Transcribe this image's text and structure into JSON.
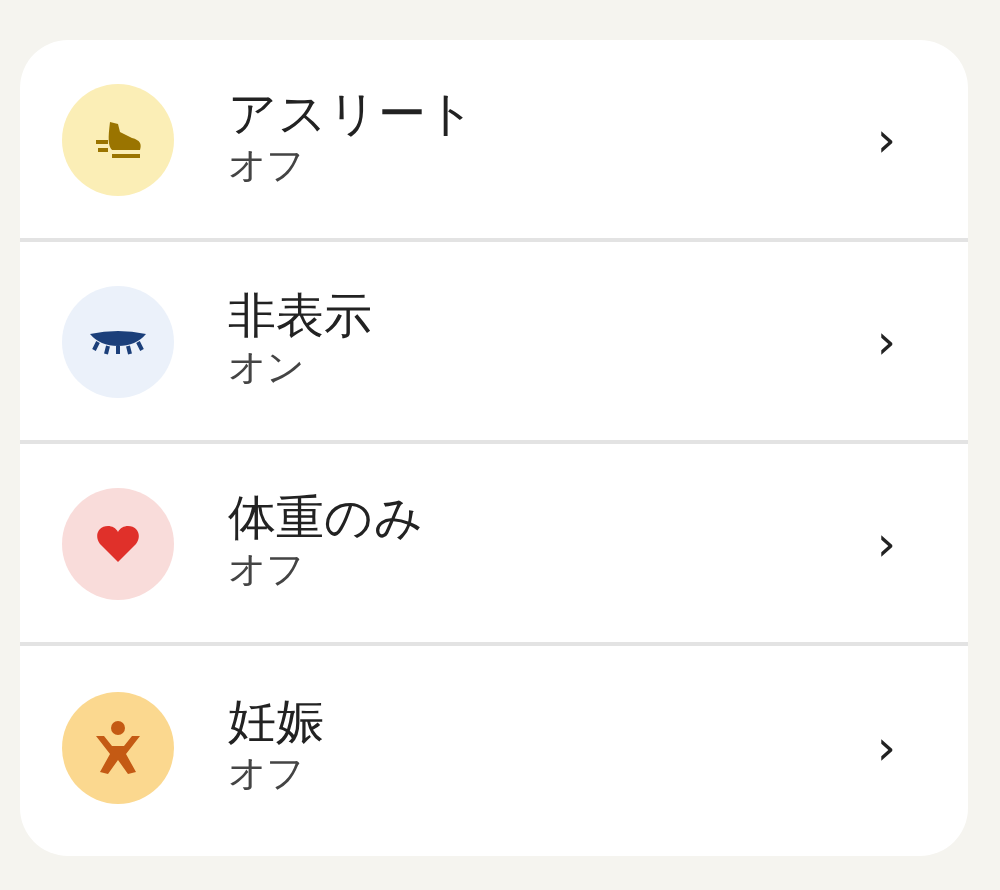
{
  "items": [
    {
      "kind": "athlete",
      "title": "アスリート",
      "value": "オフ",
      "chevron": "›"
    },
    {
      "kind": "hidden",
      "title": "非表示",
      "value": "オン",
      "chevron": "›"
    },
    {
      "kind": "weight",
      "title": "体重のみ",
      "value": "オフ",
      "chevron": "›"
    },
    {
      "kind": "pregnancy",
      "title": "妊娠",
      "value": "オフ",
      "chevron": "›"
    }
  ]
}
